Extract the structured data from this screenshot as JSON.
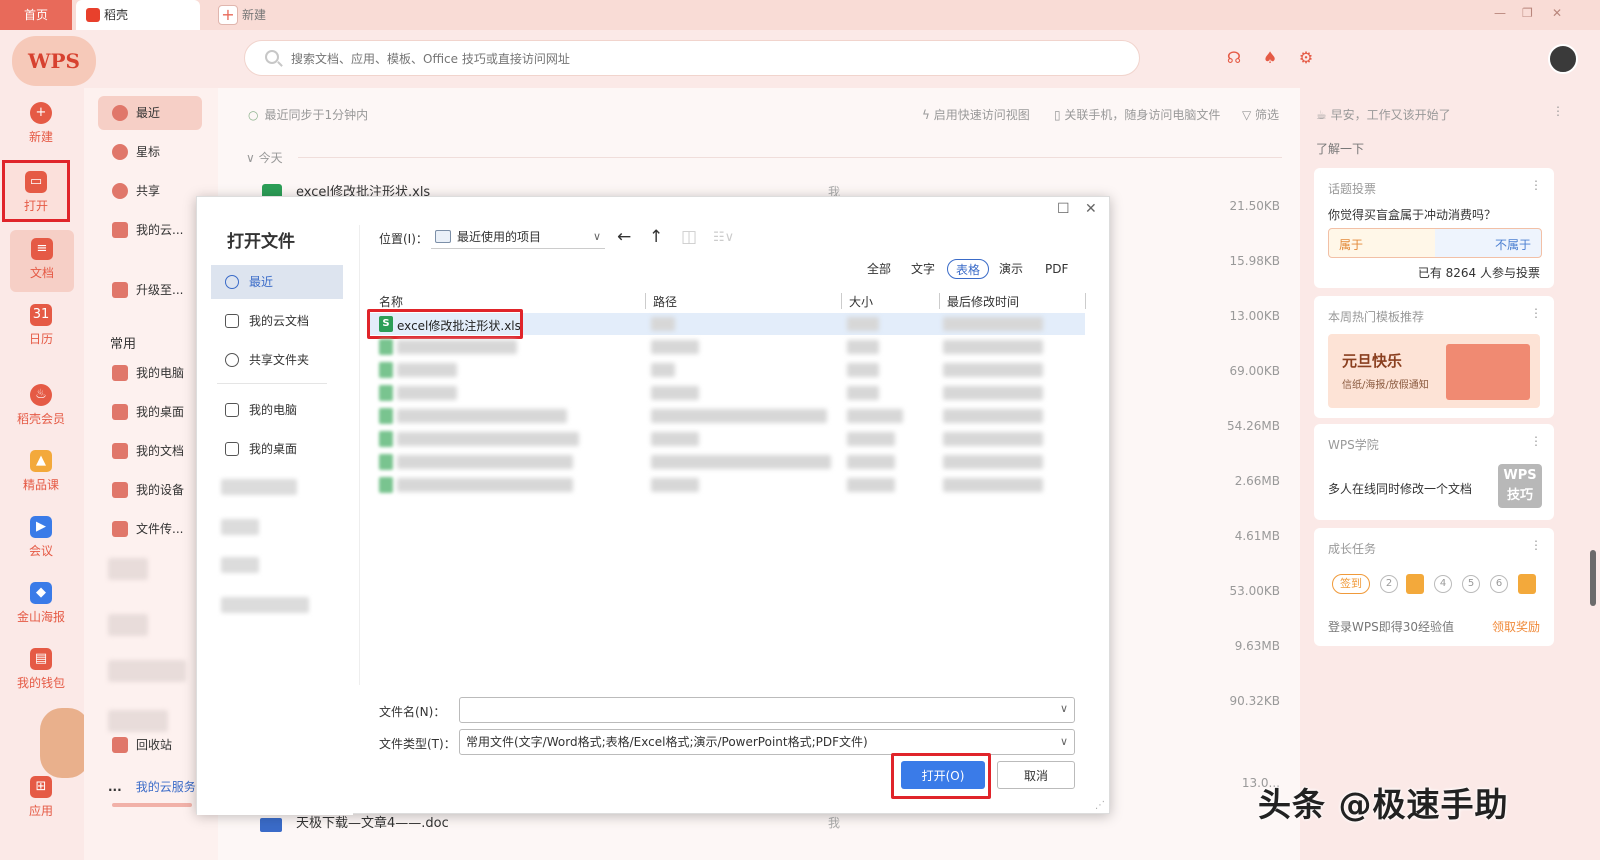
{
  "titlebar": {
    "tabs": [
      {
        "label": "首页"
      },
      {
        "label": "稻壳"
      },
      {
        "label": "新建"
      }
    ]
  },
  "header": {
    "logo": "WPS",
    "search_placeholder": "搜索文档、应用、模板、Office 技巧或直接访问网址"
  },
  "leftnav": {
    "items": [
      {
        "label": "新建",
        "icon": "plus-circle-icon"
      },
      {
        "label": "打开",
        "icon": "folder-icon"
      },
      {
        "label": "文档",
        "icon": "document-icon"
      },
      {
        "label": "日历",
        "icon": "calendar-icon"
      },
      {
        "label": "稻壳会员",
        "icon": "flame-icon"
      },
      {
        "label": "精品课",
        "icon": "graduation-cap-icon"
      },
      {
        "label": "会议",
        "icon": "video-camera-icon"
      },
      {
        "label": "金山海报",
        "icon": "poster-icon"
      },
      {
        "label": "我的钱包",
        "icon": "wallet-icon"
      },
      {
        "label": "应用",
        "icon": "apps-grid-icon"
      }
    ]
  },
  "col2": {
    "items": [
      {
        "label": "最近"
      },
      {
        "label": "星标"
      },
      {
        "label": "共享"
      },
      {
        "label": "我的云..."
      },
      {
        "label": "升级至..."
      }
    ],
    "common_label": "常用",
    "common_items": [
      {
        "label": "我的电脑"
      },
      {
        "label": "我的桌面"
      },
      {
        "label": "我的文档"
      },
      {
        "label": "我的设备"
      },
      {
        "label": "文件传..."
      }
    ],
    "trash": "回收站",
    "footer_dots": "...",
    "footer_link": "我的云服务"
  },
  "main": {
    "sync": "最近同步于1分钟内",
    "quick_view": "启用快速访问视图",
    "phone": "关联手机，随身访问电脑文件",
    "filter": "筛选",
    "today": "今天",
    "first_file": "excel修改批注形状.xls",
    "first_owner": "我",
    "sizes": [
      "21.50KB",
      "15.98KB",
      "13.00KB",
      "69.00KB",
      "54.26MB",
      "2.66MB",
      "4.61MB",
      "53.00KB",
      "9.63MB",
      "90.32KB",
      "13.0..."
    ],
    "last_file": "天极下载—文章4——.doc",
    "last_owner": "我"
  },
  "rightpanel": {
    "greeting": "早安，工作又该开始了",
    "learn": "了解一下",
    "poll": {
      "title": "话题投票",
      "question": "你觉得买盲盒属于冲动消费吗？",
      "yes": "属于",
      "no": "不属于",
      "count": "已有 8264 人参与投票"
    },
    "template": {
      "title": "本周热门模板推荐",
      "banner_title": "元旦快乐",
      "banner_sub": "信纸/海报/放假通知"
    },
    "academy": {
      "title": "WPS学院",
      "text": "多人在线同时修改一个文档",
      "badge_line1": "WPS",
      "badge_line2": "技巧"
    },
    "task": {
      "title": "成长任务",
      "sign": "签到",
      "steps": [
        "2",
        "4",
        "5",
        "6"
      ],
      "text": "登录WPS即得30经验值",
      "reward": "领取奖励"
    }
  },
  "dialog": {
    "title": "打开文件",
    "nav": [
      {
        "label": "最近"
      },
      {
        "label": "我的云文档"
      },
      {
        "label": "共享文件夹"
      },
      {
        "label": "我的电脑"
      },
      {
        "label": "我的桌面"
      }
    ],
    "location_label": "位置(I)：",
    "location_value": "最近使用的项目",
    "filters": [
      "全部",
      "文字",
      "表格",
      "演示",
      "PDF"
    ],
    "active_filter": "表格",
    "columns": [
      "名称",
      "路径",
      "大小",
      "最后修改时间"
    ],
    "selected_file": "excel修改批注形状.xls",
    "filename_label": "文件名(N)：",
    "filename_value": "",
    "filetype_label": "文件类型(T)：",
    "filetype_value": "常用文件(文字/Word格式;表格/Excel格式;演示/PowerPoint格式;PDF文件)",
    "open_button": "打开(O)",
    "cancel_button": "取消"
  },
  "watermark": "头条 @极速手助",
  "colors": {
    "brand": "#e55a45",
    "highlight_box": "#e0242a",
    "primary_button": "#3a7be8"
  }
}
